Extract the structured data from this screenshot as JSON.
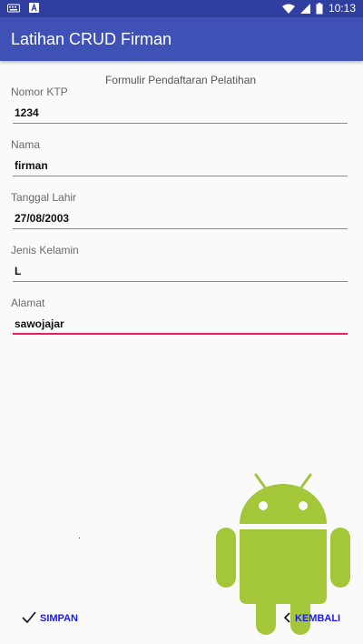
{
  "status_bar": {
    "time": "10:13",
    "left_icons": [
      "keyboard-icon",
      "notification-a-icon"
    ],
    "right_icons": [
      "wifi-icon",
      "signal-icon",
      "battery-icon"
    ]
  },
  "app_bar": {
    "title": "Latihan CRUD Firman",
    "color": "#3f51b5"
  },
  "form": {
    "header": "Formulir Pendaftaran Pelatihan",
    "fields": [
      {
        "label": "Nomor KTP",
        "value": "1234"
      },
      {
        "label": "Nama",
        "value": "firman"
      },
      {
        "label": "Tanggal Lahir",
        "value": "27/08/2003"
      },
      {
        "label": "Jenis Kelamin",
        "value": "L"
      },
      {
        "label": "Alamat",
        "value": "sawojajar"
      }
    ],
    "accent_color": "#e91e63"
  },
  "buttons": {
    "save": {
      "label": "SIMPAN",
      "icon": "check-icon"
    },
    "back": {
      "label": "KEMBALI",
      "icon": "chevron-left-icon"
    }
  },
  "android_logo": {
    "color": "#a4c639"
  }
}
